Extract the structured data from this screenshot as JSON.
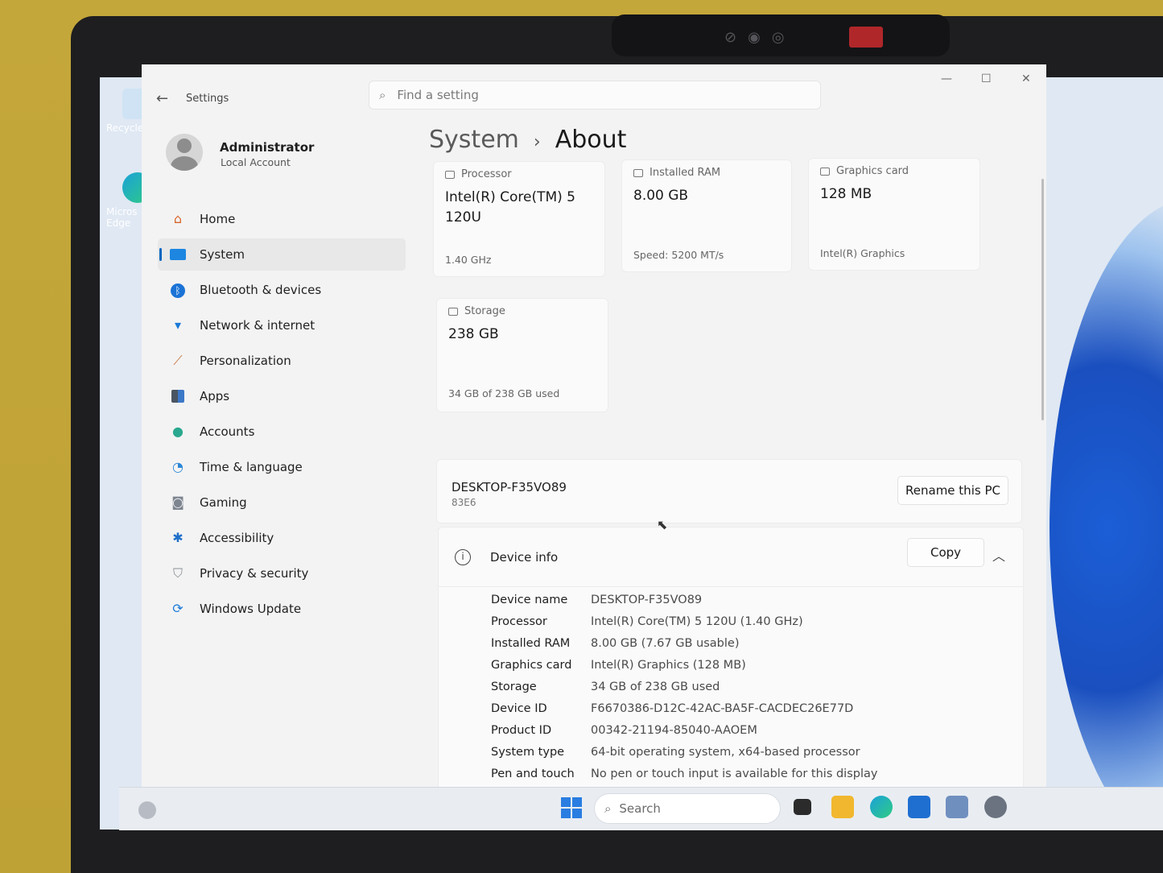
{
  "window": {
    "app_title": "Settings",
    "search_placeholder": "Find a setting",
    "controls": {
      "minimize": "—",
      "maximize": "☐",
      "close": "✕"
    }
  },
  "desktop": {
    "icons": [
      {
        "label": "Recycle",
        "icon": "recycle-bin-icon"
      },
      {
        "label": "Micros Edge",
        "icon": "edge-icon"
      }
    ]
  },
  "profile": {
    "name": "Administrator",
    "type": "Local Account"
  },
  "sidebar": {
    "items": [
      {
        "label": "Home",
        "icon": "home-icon",
        "active": false
      },
      {
        "label": "System",
        "icon": "monitor-icon",
        "active": true
      },
      {
        "label": "Bluetooth & devices",
        "icon": "bluetooth-icon",
        "active": false
      },
      {
        "label": "Network & internet",
        "icon": "wifi-icon",
        "active": false
      },
      {
        "label": "Personalization",
        "icon": "brush-icon",
        "active": false
      },
      {
        "label": "Apps",
        "icon": "apps-icon",
        "active": false
      },
      {
        "label": "Accounts",
        "icon": "person-icon",
        "active": false
      },
      {
        "label": "Time & language",
        "icon": "globe-clock-icon",
        "active": false
      },
      {
        "label": "Gaming",
        "icon": "gamepad-icon",
        "active": false
      },
      {
        "label": "Accessibility",
        "icon": "accessibility-icon",
        "active": false
      },
      {
        "label": "Privacy & security",
        "icon": "shield-icon",
        "active": false
      },
      {
        "label": "Windows Update",
        "icon": "update-icon",
        "active": false
      }
    ]
  },
  "breadcrumb": {
    "parent": "System",
    "separator": "›",
    "current": "About"
  },
  "specs": {
    "processor": {
      "label": "Processor",
      "value": "Intel(R) Core(TM) 5 120U",
      "sub": "1.40 GHz"
    },
    "ram": {
      "label": "Installed RAM",
      "value": "8.00 GB",
      "sub": "Speed: 5200 MT/s"
    },
    "graphics": {
      "label": "Graphics card",
      "value": "128 MB",
      "sub": "Intel(R) Graphics"
    },
    "storage": {
      "label": "Storage",
      "value": "238 GB",
      "sub": "34 GB of 238 GB used"
    }
  },
  "pc": {
    "name": "DESKTOP-F35VO89",
    "model": "83E6",
    "rename_label": "Rename this PC"
  },
  "device_info": {
    "title": "Device info",
    "copy_label": "Copy",
    "rows": [
      {
        "key": "Device name",
        "value": "DESKTOP-F35VO89"
      },
      {
        "key": "Processor",
        "value": "Intel(R) Core(TM) 5 120U (1.40 GHz)"
      },
      {
        "key": "Installed RAM",
        "value": "8.00 GB (7.67 GB usable)"
      },
      {
        "key": "Graphics card",
        "value": "Intel(R) Graphics (128 MB)"
      },
      {
        "key": "Storage",
        "value": "34 GB of 238 GB used"
      },
      {
        "key": "Device ID",
        "value": "F6670386-D12C-42AC-BA5F-CACDEC26E77D"
      },
      {
        "key": "Product ID",
        "value": "00342-21194-85040-AAOEM"
      },
      {
        "key": "System type",
        "value": "64-bit operating system, x64-based processor"
      },
      {
        "key": "Pen and touch",
        "value": "No pen or touch input is available for this display"
      }
    ]
  },
  "taskbar": {
    "search_label": "Search",
    "apps": [
      "task-view-icon",
      "file-explorer-icon",
      "edge-icon",
      "store-icon",
      "app-icon",
      "settings-icon"
    ]
  },
  "colors": {
    "accent": "#0067c0",
    "window_bg": "#f3f3f3",
    "card_bg": "#fafafa"
  }
}
